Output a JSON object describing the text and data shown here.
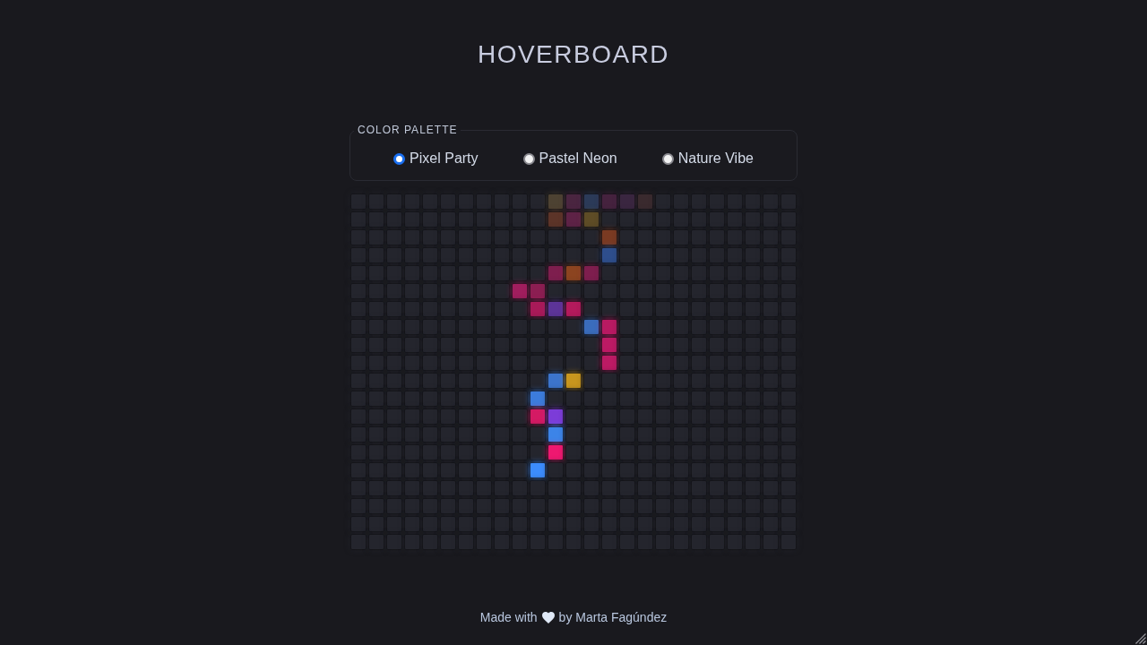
{
  "header": {
    "title": "HOVERBOARD"
  },
  "palette": {
    "legend": "COLOR PALETTE",
    "options": [
      {
        "label": "Pixel Party",
        "selected": true
      },
      {
        "label": "Pastel Neon",
        "selected": false
      },
      {
        "label": "Nature Vibe",
        "selected": false
      }
    ]
  },
  "board": {
    "rows": [
      {
        "cells": [
          {
            "color": "#24252d"
          },
          {
            "color": "#24252d"
          },
          {
            "color": "#24252d"
          },
          {
            "color": "#24252d"
          },
          {
            "color": "#24252d"
          },
          {
            "color": "#24252d"
          },
          {
            "color": "#24252d"
          },
          {
            "color": "#24252d"
          },
          {
            "color": "#24252d"
          },
          {
            "color": "#24252d"
          },
          {
            "color": "#24252d"
          },
          {
            "color": "#4d4232"
          },
          {
            "color": "#4a2540"
          },
          {
            "color": "#2b3a58"
          },
          {
            "color": "#45223e"
          },
          {
            "color": "#3a2640"
          },
          {
            "color": "#3a2a2e"
          },
          {
            "color": "#24252d"
          },
          {
            "color": "#24252d"
          },
          {
            "color": "#24252d"
          },
          {
            "color": "#24252d"
          },
          {
            "color": "#24252d"
          },
          {
            "color": "#24252d"
          },
          {
            "color": "#24252d"
          },
          {
            "color": "#24252d"
          }
        ]
      },
      {
        "cells": [
          {
            "color": "#24252d"
          },
          {
            "color": "#24252d"
          },
          {
            "color": "#24252d"
          },
          {
            "color": "#24252d"
          },
          {
            "color": "#24252d"
          },
          {
            "color": "#24252d"
          },
          {
            "color": "#24252d"
          },
          {
            "color": "#24252d"
          },
          {
            "color": "#24252d"
          },
          {
            "color": "#24252d"
          },
          {
            "color": "#24252d"
          },
          {
            "color": "#5c3428"
          },
          {
            "color": "#5e2246"
          },
          {
            "color": "#5e4c26"
          },
          {
            "color": "#24252d"
          },
          {
            "color": "#24252d"
          },
          {
            "color": "#24252d"
          },
          {
            "color": "#24252d"
          },
          {
            "color": "#24252d"
          },
          {
            "color": "#24252d"
          },
          {
            "color": "#24252d"
          },
          {
            "color": "#24252d"
          },
          {
            "color": "#24252d"
          },
          {
            "color": "#24252d"
          },
          {
            "color": "#24252d"
          }
        ]
      },
      {
        "cells": [
          {
            "color": "#24252d"
          },
          {
            "color": "#24252d"
          },
          {
            "color": "#24252d"
          },
          {
            "color": "#24252d"
          },
          {
            "color": "#24252d"
          },
          {
            "color": "#24252d"
          },
          {
            "color": "#24252d"
          },
          {
            "color": "#24252d"
          },
          {
            "color": "#24252d"
          },
          {
            "color": "#24252d"
          },
          {
            "color": "#24252d"
          },
          {
            "color": "#24252d"
          },
          {
            "color": "#24252d"
          },
          {
            "color": "#24252d"
          },
          {
            "color": "#7a3a22"
          },
          {
            "color": "#24252d"
          },
          {
            "color": "#24252d"
          },
          {
            "color": "#24252d"
          },
          {
            "color": "#24252d"
          },
          {
            "color": "#24252d"
          },
          {
            "color": "#24252d"
          },
          {
            "color": "#24252d"
          },
          {
            "color": "#24252d"
          },
          {
            "color": "#24252d"
          },
          {
            "color": "#24252d"
          }
        ]
      },
      {
        "cells": [
          {
            "color": "#24252d"
          },
          {
            "color": "#24252d"
          },
          {
            "color": "#24252d"
          },
          {
            "color": "#24252d"
          },
          {
            "color": "#24252d"
          },
          {
            "color": "#24252d"
          },
          {
            "color": "#24252d"
          },
          {
            "color": "#24252d"
          },
          {
            "color": "#24252d"
          },
          {
            "color": "#24252d"
          },
          {
            "color": "#24252d"
          },
          {
            "color": "#24252d"
          },
          {
            "color": "#24252d"
          },
          {
            "color": "#24252d"
          },
          {
            "color": "#2e4e8c"
          },
          {
            "color": "#24252d"
          },
          {
            "color": "#24252d"
          },
          {
            "color": "#24252d"
          },
          {
            "color": "#24252d"
          },
          {
            "color": "#24252d"
          },
          {
            "color": "#24252d"
          },
          {
            "color": "#24252d"
          },
          {
            "color": "#24252d"
          },
          {
            "color": "#24252d"
          },
          {
            "color": "#24252d"
          }
        ]
      },
      {
        "cells": [
          {
            "color": "#24252d"
          },
          {
            "color": "#24252d"
          },
          {
            "color": "#24252d"
          },
          {
            "color": "#24252d"
          },
          {
            "color": "#24252d"
          },
          {
            "color": "#24252d"
          },
          {
            "color": "#24252d"
          },
          {
            "color": "#24252d"
          },
          {
            "color": "#24252d"
          },
          {
            "color": "#24252d"
          },
          {
            "color": "#24252d"
          },
          {
            "color": "#7e1e4e"
          },
          {
            "color": "#8c4420"
          },
          {
            "color": "#7e1e4e"
          },
          {
            "color": "#24252d"
          },
          {
            "color": "#24252d"
          },
          {
            "color": "#24252d"
          },
          {
            "color": "#24252d"
          },
          {
            "color": "#24252d"
          },
          {
            "color": "#24252d"
          },
          {
            "color": "#24252d"
          },
          {
            "color": "#24252d"
          },
          {
            "color": "#24252d"
          },
          {
            "color": "#24252d"
          },
          {
            "color": "#24252d"
          }
        ]
      },
      {
        "cells": [
          {
            "color": "#24252d"
          },
          {
            "color": "#24252d"
          },
          {
            "color": "#24252d"
          },
          {
            "color": "#24252d"
          },
          {
            "color": "#24252d"
          },
          {
            "color": "#24252d"
          },
          {
            "color": "#24252d"
          },
          {
            "color": "#24252d"
          },
          {
            "color": "#24252d"
          },
          {
            "color": "#a01e5e"
          },
          {
            "color": "#8c1e52"
          },
          {
            "color": "#24252d"
          },
          {
            "color": "#24252d"
          },
          {
            "color": "#24252d"
          },
          {
            "color": "#24252d"
          },
          {
            "color": "#24252d"
          },
          {
            "color": "#24252d"
          },
          {
            "color": "#24252d"
          },
          {
            "color": "#24252d"
          },
          {
            "color": "#24252d"
          },
          {
            "color": "#24252d"
          },
          {
            "color": "#24252d"
          },
          {
            "color": "#24252d"
          },
          {
            "color": "#24252d"
          },
          {
            "color": "#24252d"
          }
        ]
      },
      {
        "cells": [
          {
            "color": "#24252d"
          },
          {
            "color": "#24252d"
          },
          {
            "color": "#24252d"
          },
          {
            "color": "#24252d"
          },
          {
            "color": "#24252d"
          },
          {
            "color": "#24252d"
          },
          {
            "color": "#24252d"
          },
          {
            "color": "#24252d"
          },
          {
            "color": "#24252d"
          },
          {
            "color": "#24252d"
          },
          {
            "color": "#a81a58"
          },
          {
            "color": "#5c3498"
          },
          {
            "color": "#b41a5c"
          },
          {
            "color": "#24252d"
          },
          {
            "color": "#24252d"
          },
          {
            "color": "#24252d"
          },
          {
            "color": "#24252d"
          },
          {
            "color": "#24252d"
          },
          {
            "color": "#24252d"
          },
          {
            "color": "#24252d"
          },
          {
            "color": "#24252d"
          },
          {
            "color": "#24252d"
          },
          {
            "color": "#24252d"
          },
          {
            "color": "#24252d"
          },
          {
            "color": "#24252d"
          }
        ]
      },
      {
        "cells": [
          {
            "color": "#24252d"
          },
          {
            "color": "#24252d"
          },
          {
            "color": "#24252d"
          },
          {
            "color": "#24252d"
          },
          {
            "color": "#24252d"
          },
          {
            "color": "#24252d"
          },
          {
            "color": "#24252d"
          },
          {
            "color": "#24252d"
          },
          {
            "color": "#24252d"
          },
          {
            "color": "#24252d"
          },
          {
            "color": "#24252d"
          },
          {
            "color": "#24252d"
          },
          {
            "color": "#24252d"
          },
          {
            "color": "#3a6cbc"
          },
          {
            "color": "#b81a62"
          },
          {
            "color": "#24252d"
          },
          {
            "color": "#24252d"
          },
          {
            "color": "#24252d"
          },
          {
            "color": "#24252d"
          },
          {
            "color": "#24252d"
          },
          {
            "color": "#24252d"
          },
          {
            "color": "#24252d"
          },
          {
            "color": "#24252d"
          },
          {
            "color": "#24252d"
          },
          {
            "color": "#24252d"
          }
        ]
      },
      {
        "cells": [
          {
            "color": "#24252d"
          },
          {
            "color": "#24252d"
          },
          {
            "color": "#24252d"
          },
          {
            "color": "#24252d"
          },
          {
            "color": "#24252d"
          },
          {
            "color": "#24252d"
          },
          {
            "color": "#24252d"
          },
          {
            "color": "#24252d"
          },
          {
            "color": "#24252d"
          },
          {
            "color": "#24252d"
          },
          {
            "color": "#24252d"
          },
          {
            "color": "#24252d"
          },
          {
            "color": "#24252d"
          },
          {
            "color": "#24252d"
          },
          {
            "color": "#bc1a64"
          },
          {
            "color": "#24252d"
          },
          {
            "color": "#24252d"
          },
          {
            "color": "#24252d"
          },
          {
            "color": "#24252d"
          },
          {
            "color": "#24252d"
          },
          {
            "color": "#24252d"
          },
          {
            "color": "#24252d"
          },
          {
            "color": "#24252d"
          },
          {
            "color": "#24252d"
          },
          {
            "color": "#24252d"
          }
        ]
      },
      {
        "cells": [
          {
            "color": "#24252d"
          },
          {
            "color": "#24252d"
          },
          {
            "color": "#24252d"
          },
          {
            "color": "#24252d"
          },
          {
            "color": "#24252d"
          },
          {
            "color": "#24252d"
          },
          {
            "color": "#24252d"
          },
          {
            "color": "#24252d"
          },
          {
            "color": "#24252d"
          },
          {
            "color": "#24252d"
          },
          {
            "color": "#24252d"
          },
          {
            "color": "#24252d"
          },
          {
            "color": "#24252d"
          },
          {
            "color": "#24252d"
          },
          {
            "color": "#bc1a64"
          },
          {
            "color": "#24252d"
          },
          {
            "color": "#24252d"
          },
          {
            "color": "#24252d"
          },
          {
            "color": "#24252d"
          },
          {
            "color": "#24252d"
          },
          {
            "color": "#24252d"
          },
          {
            "color": "#24252d"
          },
          {
            "color": "#24252d"
          },
          {
            "color": "#24252d"
          },
          {
            "color": "#24252d"
          }
        ]
      },
      {
        "cells": [
          {
            "color": "#24252d"
          },
          {
            "color": "#24252d"
          },
          {
            "color": "#24252d"
          },
          {
            "color": "#24252d"
          },
          {
            "color": "#24252d"
          },
          {
            "color": "#24252d"
          },
          {
            "color": "#24252d"
          },
          {
            "color": "#24252d"
          },
          {
            "color": "#24252d"
          },
          {
            "color": "#24252d"
          },
          {
            "color": "#24252d"
          },
          {
            "color": "#3c74cc"
          },
          {
            "color": "#c8961e"
          },
          {
            "color": "#24252d"
          },
          {
            "color": "#24252d"
          },
          {
            "color": "#24252d"
          },
          {
            "color": "#24252d"
          },
          {
            "color": "#24252d"
          },
          {
            "color": "#24252d"
          },
          {
            "color": "#24252d"
          },
          {
            "color": "#24252d"
          },
          {
            "color": "#24252d"
          },
          {
            "color": "#24252d"
          },
          {
            "color": "#24252d"
          },
          {
            "color": "#24252d"
          }
        ]
      },
      {
        "cells": [
          {
            "color": "#24252d"
          },
          {
            "color": "#24252d"
          },
          {
            "color": "#24252d"
          },
          {
            "color": "#24252d"
          },
          {
            "color": "#24252d"
          },
          {
            "color": "#24252d"
          },
          {
            "color": "#24252d"
          },
          {
            "color": "#24252d"
          },
          {
            "color": "#24252d"
          },
          {
            "color": "#24252d"
          },
          {
            "color": "#3c7cdc"
          },
          {
            "color": "#24252d"
          },
          {
            "color": "#24252d"
          },
          {
            "color": "#24252d"
          },
          {
            "color": "#24252d"
          },
          {
            "color": "#24252d"
          },
          {
            "color": "#24252d"
          },
          {
            "color": "#24252d"
          },
          {
            "color": "#24252d"
          },
          {
            "color": "#24252d"
          },
          {
            "color": "#24252d"
          },
          {
            "color": "#24252d"
          },
          {
            "color": "#24252d"
          },
          {
            "color": "#24252d"
          },
          {
            "color": "#24252d"
          }
        ]
      },
      {
        "cells": [
          {
            "color": "#24252d"
          },
          {
            "color": "#24252d"
          },
          {
            "color": "#24252d"
          },
          {
            "color": "#24252d"
          },
          {
            "color": "#24252d"
          },
          {
            "color": "#24252d"
          },
          {
            "color": "#24252d"
          },
          {
            "color": "#24252d"
          },
          {
            "color": "#24252d"
          },
          {
            "color": "#24252d"
          },
          {
            "color": "#d41a64"
          },
          {
            "color": "#7c3cd8"
          },
          {
            "color": "#24252d"
          },
          {
            "color": "#24252d"
          },
          {
            "color": "#24252d"
          },
          {
            "color": "#24252d"
          },
          {
            "color": "#24252d"
          },
          {
            "color": "#24252d"
          },
          {
            "color": "#24252d"
          },
          {
            "color": "#24252d"
          },
          {
            "color": "#24252d"
          },
          {
            "color": "#24252d"
          },
          {
            "color": "#24252d"
          },
          {
            "color": "#24252d"
          },
          {
            "color": "#24252d"
          }
        ]
      },
      {
        "cells": [
          {
            "color": "#24252d"
          },
          {
            "color": "#24252d"
          },
          {
            "color": "#24252d"
          },
          {
            "color": "#24252d"
          },
          {
            "color": "#24252d"
          },
          {
            "color": "#24252d"
          },
          {
            "color": "#24252d"
          },
          {
            "color": "#24252d"
          },
          {
            "color": "#24252d"
          },
          {
            "color": "#24252d"
          },
          {
            "color": "#24252d"
          },
          {
            "color": "#3c84e8"
          },
          {
            "color": "#24252d"
          },
          {
            "color": "#24252d"
          },
          {
            "color": "#24252d"
          },
          {
            "color": "#24252d"
          },
          {
            "color": "#24252d"
          },
          {
            "color": "#24252d"
          },
          {
            "color": "#24252d"
          },
          {
            "color": "#24252d"
          },
          {
            "color": "#24252d"
          },
          {
            "color": "#24252d"
          },
          {
            "color": "#24252d"
          },
          {
            "color": "#24252d"
          },
          {
            "color": "#24252d"
          }
        ]
      },
      {
        "cells": [
          {
            "color": "#24252d"
          },
          {
            "color": "#24252d"
          },
          {
            "color": "#24252d"
          },
          {
            "color": "#24252d"
          },
          {
            "color": "#24252d"
          },
          {
            "color": "#24252d"
          },
          {
            "color": "#24252d"
          },
          {
            "color": "#24252d"
          },
          {
            "color": "#24252d"
          },
          {
            "color": "#24252d"
          },
          {
            "color": "#24252d"
          },
          {
            "color": "#ee1870"
          },
          {
            "color": "#24252d"
          },
          {
            "color": "#24252d"
          },
          {
            "color": "#24252d"
          },
          {
            "color": "#24252d"
          },
          {
            "color": "#24252d"
          },
          {
            "color": "#24252d"
          },
          {
            "color": "#24252d"
          },
          {
            "color": "#24252d"
          },
          {
            "color": "#24252d"
          },
          {
            "color": "#24252d"
          },
          {
            "color": "#24252d"
          },
          {
            "color": "#24252d"
          },
          {
            "color": "#24252d"
          }
        ]
      },
      {
        "cells": [
          {
            "color": "#24252d"
          },
          {
            "color": "#24252d"
          },
          {
            "color": "#24252d"
          },
          {
            "color": "#24252d"
          },
          {
            "color": "#24252d"
          },
          {
            "color": "#24252d"
          },
          {
            "color": "#24252d"
          },
          {
            "color": "#24252d"
          },
          {
            "color": "#24252d"
          },
          {
            "color": "#24252d"
          },
          {
            "color": "#3c8cfc"
          },
          {
            "color": "#24252d"
          },
          {
            "color": "#24252d"
          },
          {
            "color": "#24252d"
          },
          {
            "color": "#24252d"
          },
          {
            "color": "#24252d"
          },
          {
            "color": "#24252d"
          },
          {
            "color": "#24252d"
          },
          {
            "color": "#24252d"
          },
          {
            "color": "#24252d"
          },
          {
            "color": "#24252d"
          },
          {
            "color": "#24252d"
          },
          {
            "color": "#24252d"
          },
          {
            "color": "#24252d"
          },
          {
            "color": "#24252d"
          }
        ]
      },
      {
        "cells": [
          {
            "color": "#24252d"
          },
          {
            "color": "#24252d"
          },
          {
            "color": "#24252d"
          },
          {
            "color": "#24252d"
          },
          {
            "color": "#24252d"
          },
          {
            "color": "#24252d"
          },
          {
            "color": "#24252d"
          },
          {
            "color": "#24252d"
          },
          {
            "color": "#24252d"
          },
          {
            "color": "#24252d"
          },
          {
            "color": "#24252d"
          },
          {
            "color": "#24252d"
          },
          {
            "color": "#24252d"
          },
          {
            "color": "#24252d"
          },
          {
            "color": "#24252d"
          },
          {
            "color": "#24252d"
          },
          {
            "color": "#24252d"
          },
          {
            "color": "#24252d"
          },
          {
            "color": "#24252d"
          },
          {
            "color": "#24252d"
          },
          {
            "color": "#24252d"
          },
          {
            "color": "#24252d"
          },
          {
            "color": "#24252d"
          },
          {
            "color": "#24252d"
          },
          {
            "color": "#24252d"
          }
        ]
      },
      {
        "cells": [
          {
            "color": "#24252d"
          },
          {
            "color": "#24252d"
          },
          {
            "color": "#24252d"
          },
          {
            "color": "#24252d"
          },
          {
            "color": "#24252d"
          },
          {
            "color": "#24252d"
          },
          {
            "color": "#24252d"
          },
          {
            "color": "#24252d"
          },
          {
            "color": "#24252d"
          },
          {
            "color": "#24252d"
          },
          {
            "color": "#24252d"
          },
          {
            "color": "#24252d"
          },
          {
            "color": "#24252d"
          },
          {
            "color": "#24252d"
          },
          {
            "color": "#24252d"
          },
          {
            "color": "#24252d"
          },
          {
            "color": "#24252d"
          },
          {
            "color": "#24252d"
          },
          {
            "color": "#24252d"
          },
          {
            "color": "#24252d"
          },
          {
            "color": "#24252d"
          },
          {
            "color": "#24252d"
          },
          {
            "color": "#24252d"
          },
          {
            "color": "#24252d"
          },
          {
            "color": "#24252d"
          }
        ]
      },
      {
        "cells": [
          {
            "color": "#24252d"
          },
          {
            "color": "#24252d"
          },
          {
            "color": "#24252d"
          },
          {
            "color": "#24252d"
          },
          {
            "color": "#24252d"
          },
          {
            "color": "#24252d"
          },
          {
            "color": "#24252d"
          },
          {
            "color": "#24252d"
          },
          {
            "color": "#24252d"
          },
          {
            "color": "#24252d"
          },
          {
            "color": "#24252d"
          },
          {
            "color": "#24252d"
          },
          {
            "color": "#24252d"
          },
          {
            "color": "#24252d"
          },
          {
            "color": "#24252d"
          },
          {
            "color": "#24252d"
          },
          {
            "color": "#24252d"
          },
          {
            "color": "#24252d"
          },
          {
            "color": "#24252d"
          },
          {
            "color": "#24252d"
          },
          {
            "color": "#24252d"
          },
          {
            "color": "#24252d"
          },
          {
            "color": "#24252d"
          },
          {
            "color": "#24252d"
          },
          {
            "color": "#24252d"
          }
        ]
      },
      {
        "cells": [
          {
            "color": "#24252d"
          },
          {
            "color": "#24252d"
          },
          {
            "color": "#24252d"
          },
          {
            "color": "#24252d"
          },
          {
            "color": "#24252d"
          },
          {
            "color": "#24252d"
          },
          {
            "color": "#24252d"
          },
          {
            "color": "#24252d"
          },
          {
            "color": "#24252d"
          },
          {
            "color": "#24252d"
          },
          {
            "color": "#24252d"
          },
          {
            "color": "#24252d"
          },
          {
            "color": "#24252d"
          },
          {
            "color": "#24252d"
          },
          {
            "color": "#24252d"
          },
          {
            "color": "#24252d"
          },
          {
            "color": "#24252d"
          },
          {
            "color": "#24252d"
          },
          {
            "color": "#24252d"
          },
          {
            "color": "#24252d"
          },
          {
            "color": "#24252d"
          },
          {
            "color": "#24252d"
          },
          {
            "color": "#24252d"
          },
          {
            "color": "#24252d"
          },
          {
            "color": "#24252d"
          }
        ]
      }
    ]
  },
  "footer": {
    "text_before": "Made with",
    "text_after": "by Marta Fagúndez"
  }
}
